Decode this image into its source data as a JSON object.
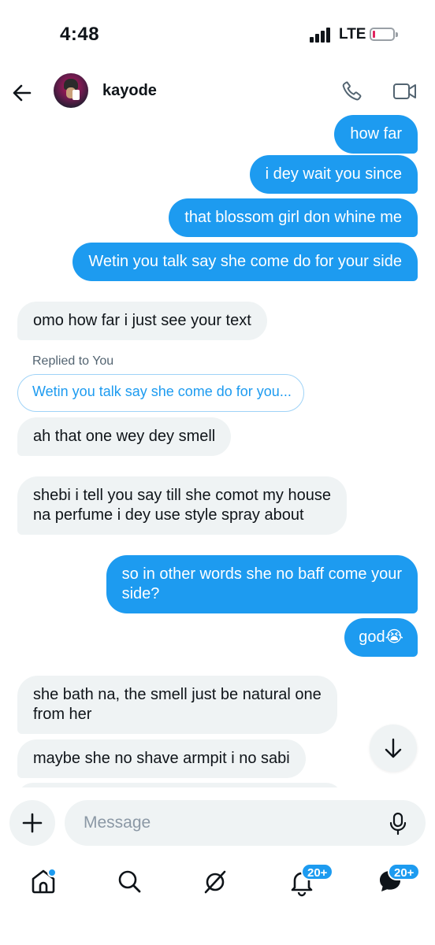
{
  "status_bar": {
    "time": "4:48",
    "network": "LTE"
  },
  "header": {
    "contact_name": "kayode"
  },
  "messages": {
    "out_1": "how far",
    "out_2": "i dey wait you since",
    "out_3": "that blossom girl don whine me",
    "out_4": "Wetin you talk say she come do for your side",
    "in_1": "omo how far i just see your text",
    "reply_label": "Replied to You",
    "reply_quote": "Wetin you talk say she come do for you...",
    "in_2": "ah that one wey dey smell",
    "in_3_line1": "shebi i tell you say till she comot my house",
    "in_3_line2": "na perfume i dey use style spray about",
    "out_5_line1": "so in other words she no baff come your",
    "out_5_line2": "side?",
    "out_6": "god",
    "out_6_emoji": "😭",
    "in_4_line1": "she bath na, the smell just be natural one",
    "in_4_line2": "from her",
    "in_5": "maybe she no shave armpit i no sabi"
  },
  "composer": {
    "placeholder": "Message"
  },
  "bottom_nav": {
    "notifications_badge": "20+",
    "messages_badge": "20+"
  },
  "colors": {
    "accent": "#1d9bf0",
    "incoming_bubble": "#eff3f4",
    "text": "#0f1419"
  }
}
